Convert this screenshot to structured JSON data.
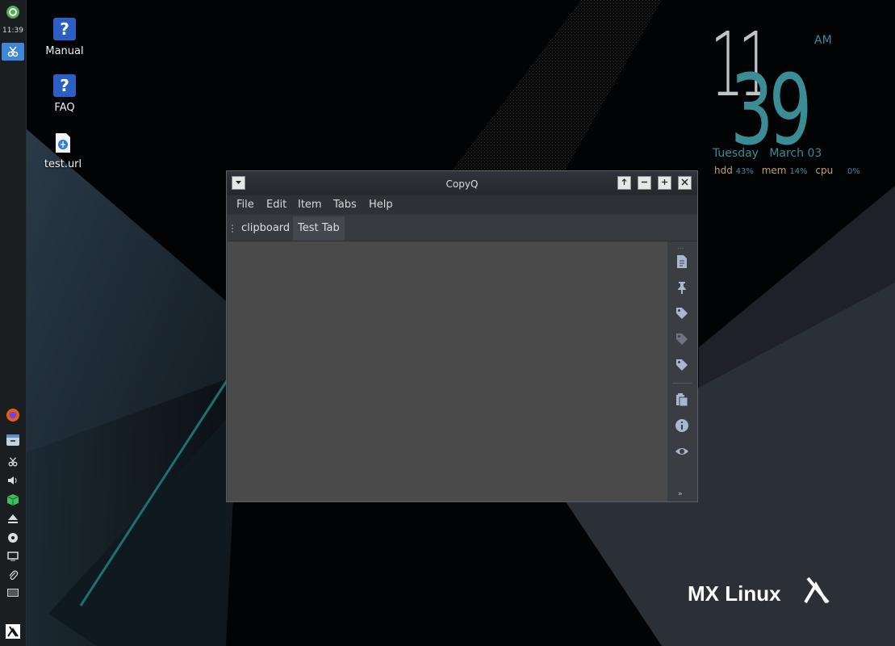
{
  "panel": {
    "clock": "11:39"
  },
  "desktop": {
    "icons": [
      {
        "label": "Manual"
      },
      {
        "label": "FAQ"
      },
      {
        "label": "test.url"
      }
    ],
    "brand": "MX Linux"
  },
  "conky": {
    "hour": "11",
    "minute": "39",
    "ampm": "AM",
    "day": "Tuesday",
    "date": "March 03",
    "hdd_label": "hdd",
    "hdd_value": "43%",
    "mem_label": "mem",
    "mem_value": "14%",
    "cpu_label": "cpu",
    "cpu_value": "0%"
  },
  "window": {
    "title": "CopyQ",
    "menu": [
      "File",
      "Edit",
      "Item",
      "Tabs",
      "Help"
    ],
    "tabs": [
      {
        "label": "clipboard",
        "active": false
      },
      {
        "label": "Test Tab",
        "active": true
      }
    ]
  },
  "colors": {
    "accent": "#3a8d94",
    "panel": "#1b1e21"
  }
}
